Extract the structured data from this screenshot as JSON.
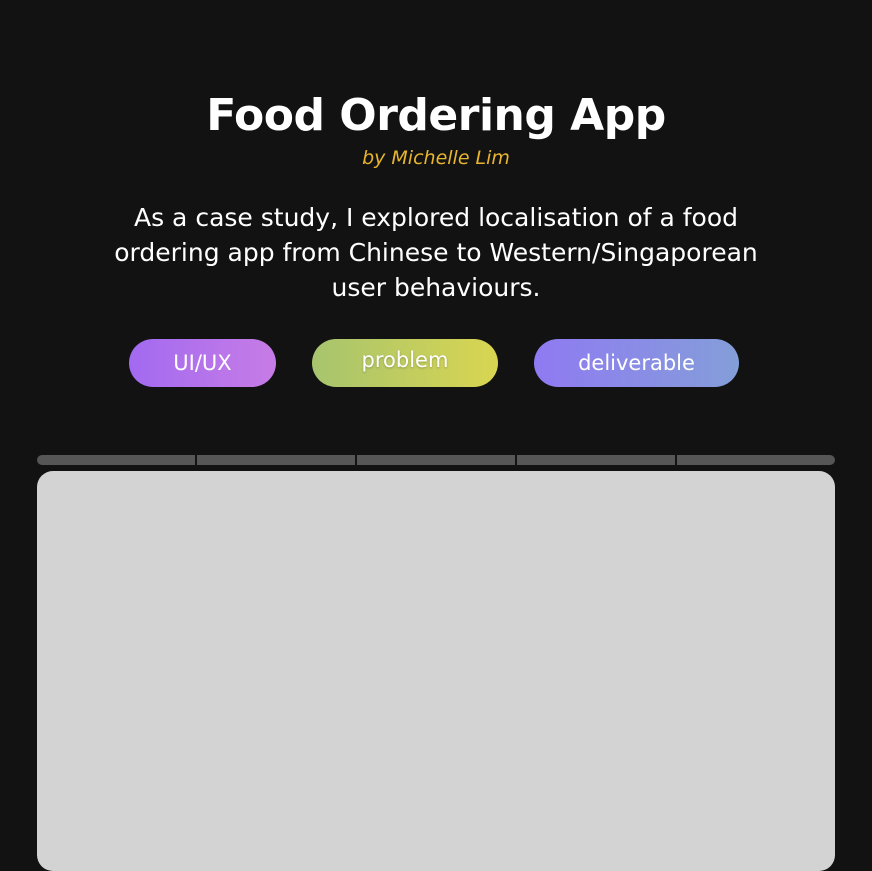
{
  "header": {
    "title": "Food Ordering App",
    "byline": "by Michelle Lim",
    "description": "As a case study, I explored localisation of a food ordering app from Chinese to Western/Singaporean user behaviours."
  },
  "tags": [
    {
      "label": "UI/UX"
    },
    {
      "label": "problem"
    },
    {
      "label": "deliverable"
    }
  ],
  "carousel": {
    "segments": 5
  },
  "colors": {
    "background": "#121212",
    "byline": "#e7b52e",
    "viewer": "#d3d3d3"
  }
}
